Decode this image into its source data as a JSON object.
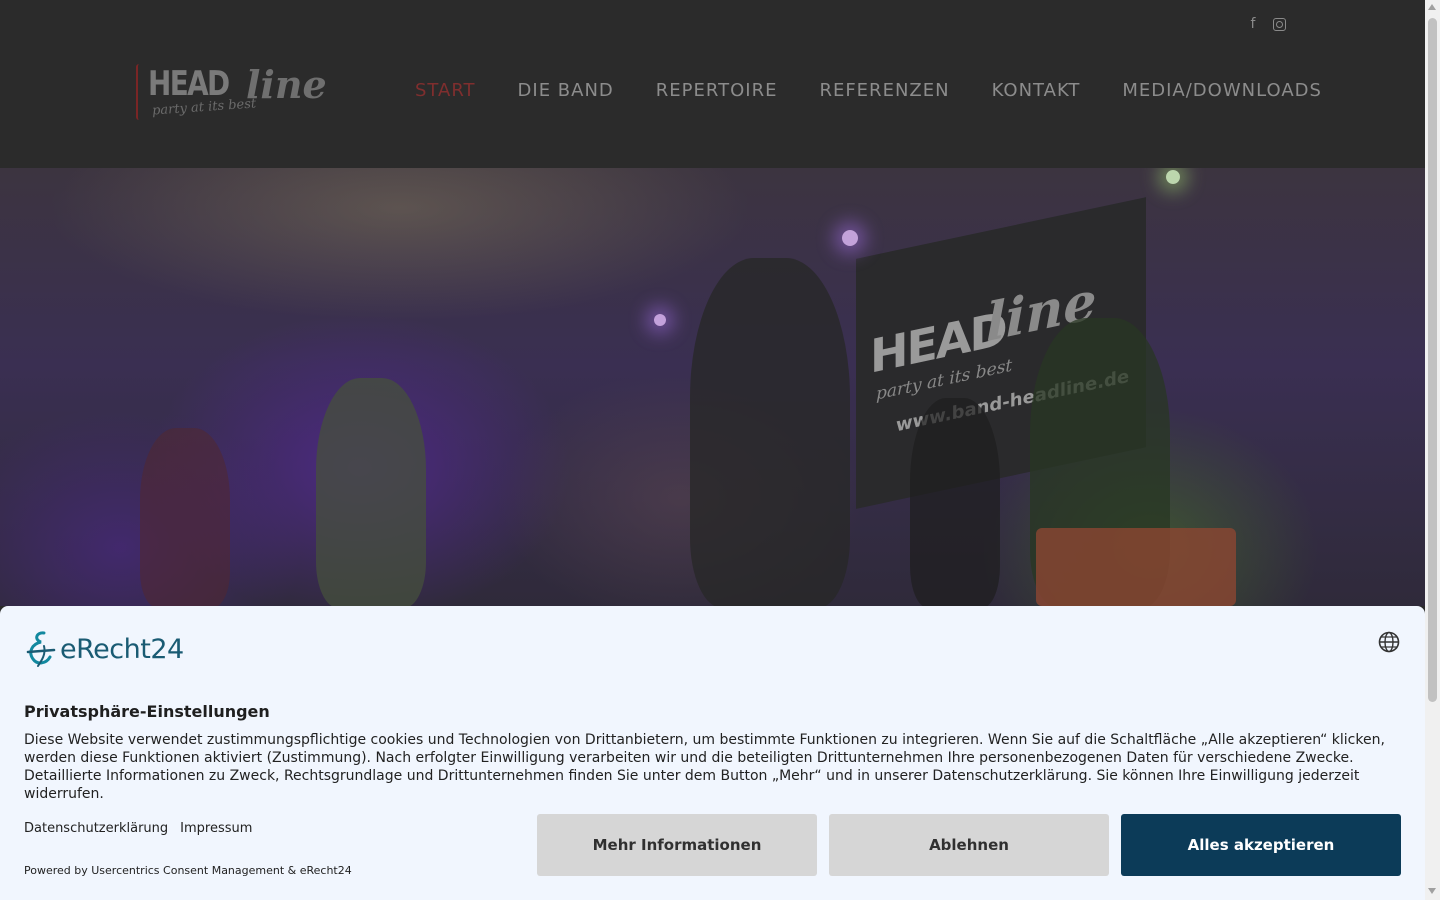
{
  "header": {
    "logo": {
      "word": "HEAD",
      "script": "line",
      "tagline": "party at its best"
    },
    "social": [
      {
        "icon": "facebook-icon",
        "glyph": "f"
      },
      {
        "icon": "instagram-icon"
      }
    ],
    "nav": [
      {
        "label": "START",
        "active": true
      },
      {
        "label": "DIE BAND",
        "active": false
      },
      {
        "label": "REPERTOIRE",
        "active": false
      },
      {
        "label": "REFERENZEN",
        "active": false
      },
      {
        "label": "KONTAKT",
        "active": false
      },
      {
        "label": "MEDIA/DOWNLOADS",
        "active": false
      }
    ],
    "colors": {
      "background": "#2b2b2b",
      "nav_text": "#8c8c8c",
      "nav_active": "#7f2e2e"
    }
  },
  "hero": {
    "banner": {
      "word": "HEAD",
      "script": "line",
      "tagline": "party at its best",
      "url": "www.band-headline.de"
    }
  },
  "consent": {
    "brand": "eRecht24",
    "title": "Privatsphäre-Einstellungen",
    "text": "Diese Website verwendet zustimmungspflichtige cookies und Technologien von Drittanbietern, um bestimmte Funktionen zu integrieren. Wenn Sie auf die Schaltfläche „Alle akzeptieren“ klicken, werden diese Funktionen aktiviert (Zustimmung). Nach erfolgter Einwilligung verarbeiten wir und die beteiligten Drittunternehmen Ihre personenbezogenen Daten für verschiedene Zwecke. Detaillierte Informationen zu Zweck, Rechtsgrundlage und Drittunternehmen finden Sie unter dem Button „Mehr“ und in unserer Datenschutzerklärung. Sie können Ihre Einwilligung jederzeit widerrufen.",
    "links": [
      "Datenschutzerklärung",
      "Impressum"
    ],
    "powered_by": "Powered by Usercentrics Consent Management & eRecht24",
    "buttons": {
      "more": "Mehr Informationen",
      "deny": "Ablehnen",
      "accept": "Alles akzeptieren"
    },
    "colors": {
      "background": "#f1f6fe",
      "accept": "#0c3b58",
      "secondary": "#d6d6d6",
      "brand": "#1a5b73"
    }
  }
}
